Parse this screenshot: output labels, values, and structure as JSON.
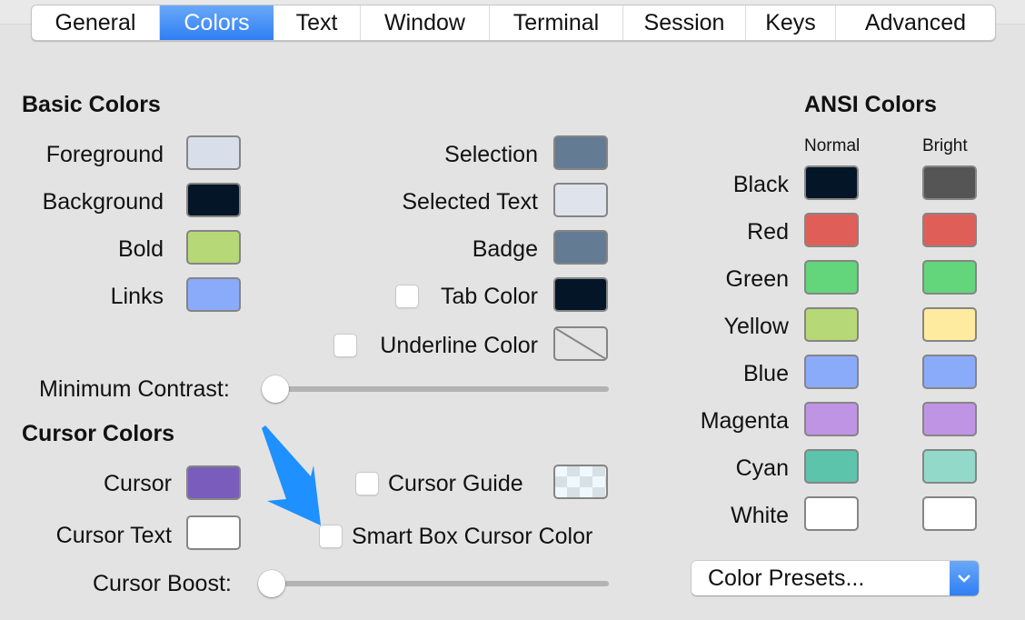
{
  "tabs": [
    {
      "label": "General",
      "active": false
    },
    {
      "label": "Colors",
      "active": true
    },
    {
      "label": "Text",
      "active": false
    },
    {
      "label": "Window",
      "active": false
    },
    {
      "label": "Terminal",
      "active": false
    },
    {
      "label": "Session",
      "active": false
    },
    {
      "label": "Keys",
      "active": false
    },
    {
      "label": "Advanced",
      "active": false
    }
  ],
  "basic": {
    "heading": "Basic Colors",
    "left": [
      {
        "label": "Foreground",
        "color": "#d9dfea"
      },
      {
        "label": "Background",
        "color": "#041527"
      },
      {
        "label": "Bold",
        "color": "#b7d877"
      },
      {
        "label": "Links",
        "color": "#89abfa"
      }
    ],
    "right": [
      {
        "label": "Selection",
        "color": "#637c94"
      },
      {
        "label": "Selected Text",
        "color": "#dfe3ec"
      },
      {
        "label": "Badge",
        "color": "#637c94"
      },
      {
        "label": "Tab Color",
        "color": "#041527",
        "checkbox": true,
        "checked": false
      },
      {
        "label": "Underline Color",
        "color": "none",
        "checkbox": true,
        "checked": false
      }
    ],
    "min_contrast": {
      "label": "Minimum Contrast:",
      "value": 0
    }
  },
  "cursor": {
    "heading": "Cursor Colors",
    "cursor": {
      "label": "Cursor",
      "color": "#7a5cbd"
    },
    "cursor_text": {
      "label": "Cursor Text",
      "color": "#ffffff"
    },
    "cursor_guide": {
      "label": "Cursor Guide",
      "checked": false,
      "color": "checkerboard"
    },
    "smart_box": {
      "label": "Smart Box Cursor Color",
      "checked": false
    },
    "cursor_boost": {
      "label": "Cursor Boost:",
      "value": 0
    }
  },
  "ansi": {
    "heading": "ANSI Colors",
    "col_normal": "Normal",
    "col_bright": "Bright",
    "rows": [
      {
        "label": "Black",
        "normal": "#041527",
        "bright": "#555555"
      },
      {
        "label": "Red",
        "normal": "#df5f58",
        "bright": "#df5f58"
      },
      {
        "label": "Green",
        "normal": "#63d57a",
        "bright": "#63d57a"
      },
      {
        "label": "Yellow",
        "normal": "#b7d877",
        "bright": "#ffeba0"
      },
      {
        "label": "Blue",
        "normal": "#89abfa",
        "bright": "#89abfa"
      },
      {
        "label": "Magenta",
        "normal": "#c094e5",
        "bright": "#c094e5"
      },
      {
        "label": "Cyan",
        "normal": "#5cc4ab",
        "bright": "#93d9ca"
      },
      {
        "label": "White",
        "normal": "#ffffff",
        "bright": "#ffffff"
      }
    ]
  },
  "presets": {
    "label": "Color Presets..."
  },
  "annotation": {
    "arrow_color": "#1e90ff"
  }
}
